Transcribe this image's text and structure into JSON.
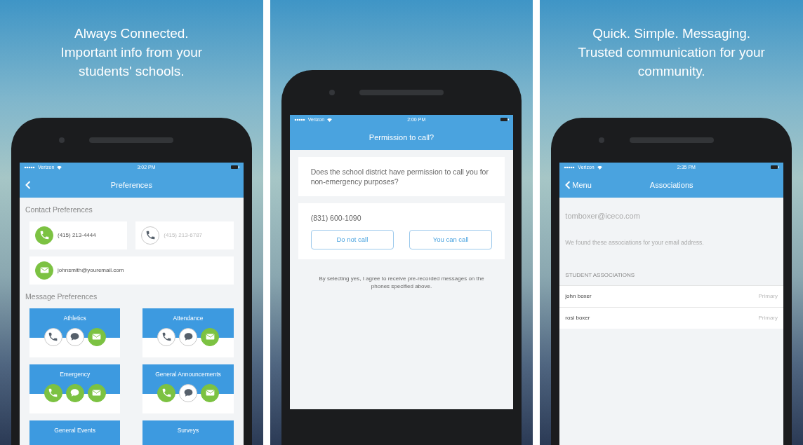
{
  "panels": [
    {
      "headline": [
        "Always Connected.",
        "Important info from your",
        "students' schools."
      ],
      "screen": {
        "kind": "preferences",
        "status_bar": {
          "carrier": "Verizon",
          "time": "3:02 PM"
        },
        "title": "Preferences",
        "contact_title": "Contact Preferences",
        "contacts": [
          {
            "kind": "phone",
            "value": "(415) 213-4444",
            "on": true
          },
          {
            "kind": "phone",
            "value": "(415) 213-6787",
            "on": false
          },
          {
            "kind": "email",
            "value": "johnsmith@youremail.com",
            "on": true
          }
        ],
        "message_title": "Message Preferences",
        "categories": [
          {
            "name": "Athletics",
            "channels": [
              {
                "kind": "phone",
                "on": false
              },
              {
                "kind": "chat",
                "on": false
              },
              {
                "kind": "email",
                "on": true
              }
            ]
          },
          {
            "name": "Attendance",
            "channels": [
              {
                "kind": "phone",
                "on": false
              },
              {
                "kind": "chat",
                "on": false
              },
              {
                "kind": "email",
                "on": true
              }
            ]
          },
          {
            "name": "Emergency",
            "channels": [
              {
                "kind": "phone",
                "on": true
              },
              {
                "kind": "chat",
                "on": true
              },
              {
                "kind": "email",
                "on": true
              }
            ]
          },
          {
            "name": "General Announcements",
            "channels": [
              {
                "kind": "phone",
                "on": true
              },
              {
                "kind": "chat",
                "on": false
              },
              {
                "kind": "email",
                "on": true
              }
            ]
          },
          {
            "name": "General Events"
          },
          {
            "name": "Surveys"
          }
        ]
      }
    },
    {
      "screen": {
        "kind": "permission",
        "status_bar": {
          "carrier": "Verizon",
          "time": "2:00 PM"
        },
        "title": "Permission to call?",
        "question": "Does the school district have permission to call you for non-emergency purposes?",
        "phone": "(831) 600-1090",
        "buttons": [
          "Do not call",
          "You can call"
        ],
        "disclaimer": "By selecting yes, I agree to receive pre-recorded messages on the phones specified above."
      }
    },
    {
      "headline": [
        "Quick. Simple. Messaging.",
        "Trusted communication for your",
        "community."
      ],
      "screen": {
        "kind": "associations",
        "status_bar": {
          "carrier": "Verizon",
          "time": "2:35 PM"
        },
        "back": "Menu",
        "title": "Associations",
        "email": "tomboxer@iceco.com",
        "message": "We found these associations for your email address.",
        "section": "STUDENT ASSOCIATIONS",
        "rows": [
          {
            "name": "john boxer",
            "role": "Primary"
          },
          {
            "name": "rosi boxer",
            "role": "Primary"
          }
        ]
      }
    }
  ]
}
